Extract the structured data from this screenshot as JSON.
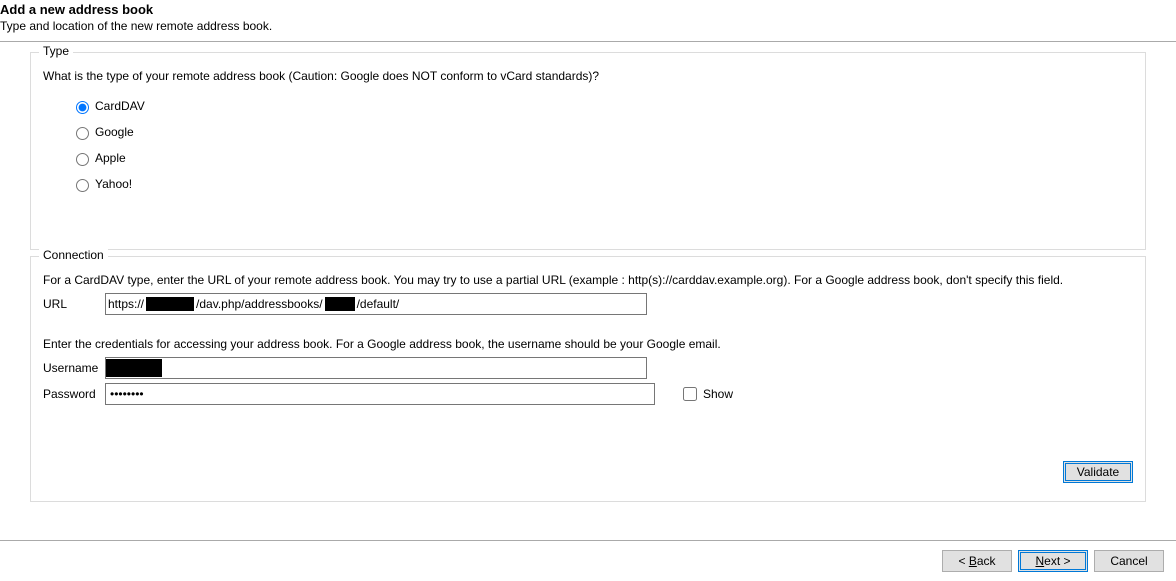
{
  "header": {
    "title": "Add a new address book",
    "subtitle": "Type and location of the new remote address book."
  },
  "type": {
    "group_label": "Type",
    "question": "What is the type of your remote address book (Caution: Google does NOT conform to vCard standards)?",
    "options": {
      "carddav": "CardDAV",
      "google": "Google",
      "apple": "Apple",
      "yahoo": "Yahoo!"
    },
    "selected": "carddav"
  },
  "connection": {
    "group_label": "Connection",
    "url_desc": "For a CardDAV type, enter the URL of your remote address book. You may try to use a partial URL (example : http(s)://carddav.example.org). For a Google address book, don't specify this field.",
    "url_label": "URL",
    "url_parts": {
      "p1": "https://",
      "p2": "/dav.php/addressbooks/",
      "p3": "/default/"
    },
    "cred_desc": "Enter the credentials for accessing your address book. For a Google address book, the username should be your Google email.",
    "username_label": "Username",
    "password_label": "Password",
    "password_value": "••••••••",
    "show_label": "Show",
    "show_checked": false,
    "validate_label": "Validate"
  },
  "footer": {
    "back": {
      "prefix": "< ",
      "accel": "B",
      "rest": "ack"
    },
    "next": {
      "accel": "N",
      "rest": "ext >"
    },
    "cancel": "Cancel"
  }
}
